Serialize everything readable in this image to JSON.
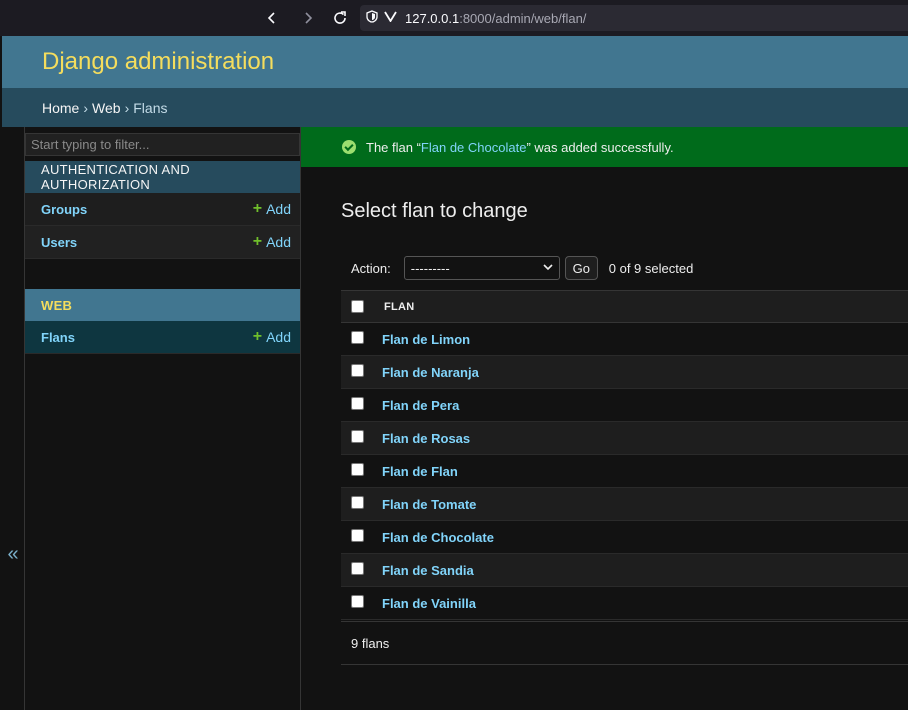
{
  "browser": {
    "url_host": "127.0.0.1",
    "url_rest": ":8000/admin/web/flan/"
  },
  "header": {
    "branding": "Django administration"
  },
  "breadcrumbs": {
    "home": "Home",
    "app": "Web",
    "model": "Flans",
    "separator": "›"
  },
  "sidebar": {
    "filter_placeholder": "Start typing to filter...",
    "collapse_label": "«",
    "modules": [
      {
        "caption": "AUTHENTICATION AND AUTHORIZATION",
        "models": [
          {
            "name": "Groups",
            "add": "Add"
          },
          {
            "name": "Users",
            "add": "Add"
          }
        ]
      },
      {
        "caption": "WEB",
        "models": [
          {
            "name": "Flans",
            "add": "Add"
          }
        ]
      }
    ]
  },
  "message": {
    "prefix": "The flan “",
    "link": "Flan de Chocolate",
    "suffix": "” was added successfully."
  },
  "content": {
    "title": "Select flan to change",
    "action_label": "Action:",
    "action_value": "---------",
    "go_label": "Go",
    "selected_count": "0 of 9 selected",
    "column_header": "FLAN",
    "rows": [
      "Flan de Limon",
      "Flan de Naranja",
      "Flan de Pera",
      "Flan de Rosas",
      "Flan de Flan",
      "Flan de Tomate",
      "Flan de Chocolate",
      "Flan de Sandia",
      "Flan de Vainilla"
    ],
    "paginator": "9 flans"
  },
  "colors": {
    "header": "#417690",
    "breadcrumbs": "#264b5d",
    "branding": "#f5dd5d",
    "link": "#81d4fa",
    "success": "#006b1b",
    "add_plus": "#70bf2b"
  }
}
